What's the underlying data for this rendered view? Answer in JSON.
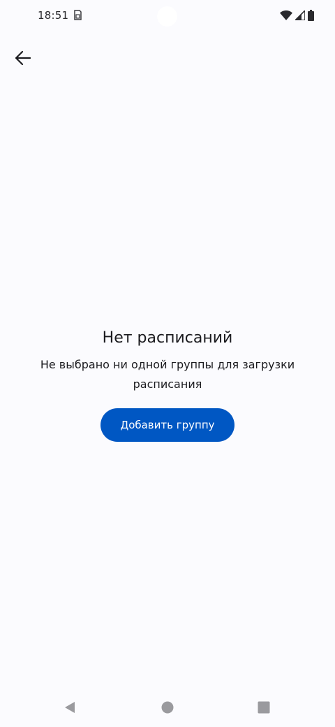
{
  "status_bar": {
    "time": "18:51",
    "icons": [
      "sim-card-icon",
      "wifi-icon",
      "cellular-signal-icon",
      "battery-icon"
    ]
  },
  "top_app_bar": {
    "back_icon": "arrow-back-icon"
  },
  "empty_state": {
    "title": "Нет расписаний",
    "subtitle": "Не выбрано ни одной группы для загрузки расписания",
    "button_label": "Добавить группу"
  },
  "navigation_bar": {
    "buttons": [
      "back-triangle-icon",
      "home-circle-icon",
      "recents-square-icon"
    ]
  },
  "colors": {
    "background": "#fbfbfe",
    "primary": "#0057c3",
    "on_primary": "#ffffff",
    "text": "#1b1b1f",
    "nav_icon": "#9a9a9e"
  }
}
